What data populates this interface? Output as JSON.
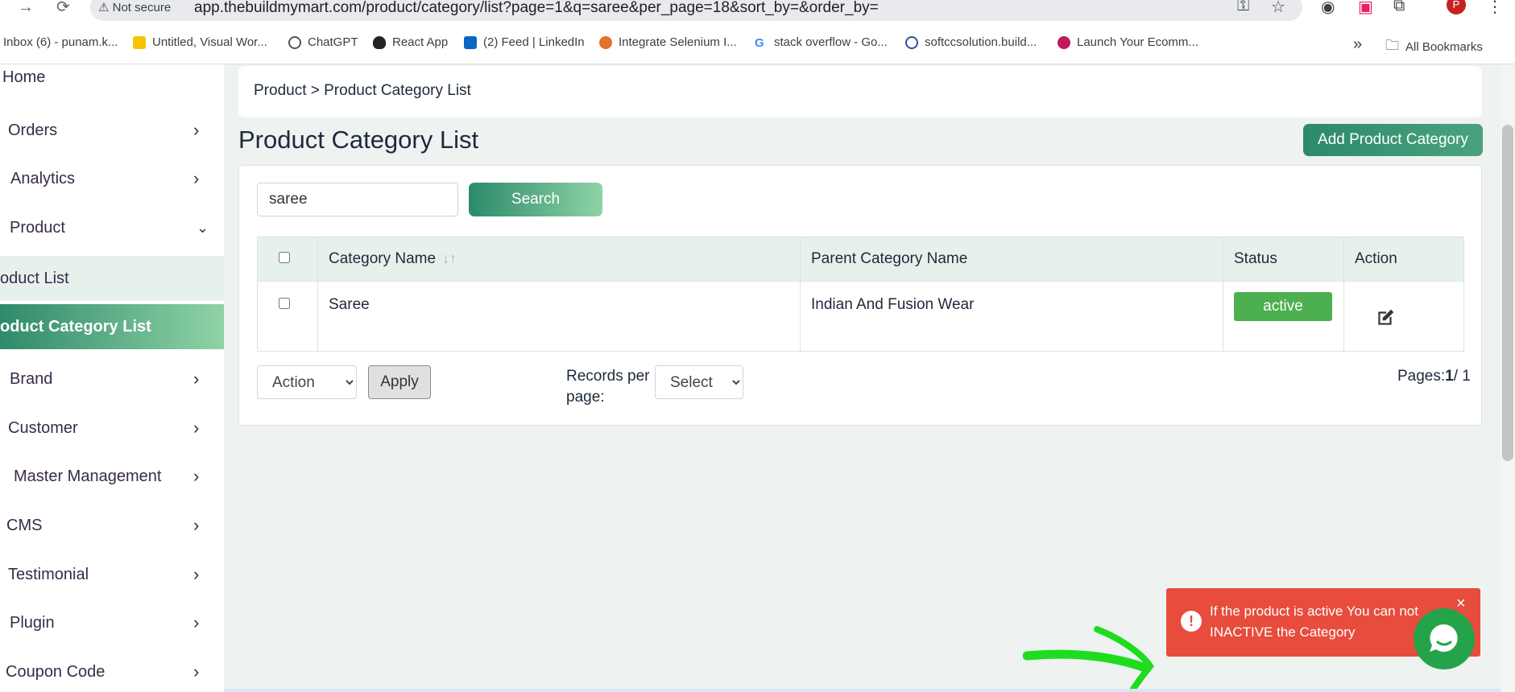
{
  "browser": {
    "security_label": "Not secure",
    "url": "app.thebuildmymart.com/product/category/list?page=1&q=saree&per_page=18&sort_by=&order_by=",
    "avatar_letter": "P",
    "bookmarks": [
      "Inbox (6) - punam.k...",
      "Untitled, Visual Wor...",
      "ChatGPT",
      "React App",
      "(2) Feed | LinkedIn",
      "Integrate Selenium I...",
      "stack overflow - Go...",
      "softccsolution.build...",
      "Launch Your Ecomm..."
    ],
    "all_bookmarks": "All Bookmarks",
    "more": "»"
  },
  "sidebar": {
    "home": "Home",
    "orders": "Orders",
    "analytics": "Analytics",
    "product": "Product",
    "product_list": "oduct List",
    "product_category_list": "oduct Category List",
    "brand": "Brand",
    "customer": "Customer",
    "master_management": "Master Management",
    "cms": "CMS",
    "testimonial": "Testimonial",
    "plugin": "Plugin",
    "coupon_code": "Coupon Code"
  },
  "breadcrumb": "Product > Product Category List",
  "page_title": "Product Category List",
  "add_button": "Add Product Category",
  "search": {
    "value": "saree",
    "button": "Search"
  },
  "table": {
    "headers": {
      "category_name": "Category Name",
      "parent_category_name": "Parent Category Name",
      "status": "Status",
      "action": "Action"
    },
    "rows": [
      {
        "category_name": "Saree",
        "parent_category_name": "Indian And Fusion Wear",
        "status": "active"
      }
    ]
  },
  "bulk": {
    "action_selected": "Action",
    "apply": "Apply"
  },
  "pagination": {
    "records_label": "Records per page:",
    "records_selected": "Select",
    "pages_label": "Pages:",
    "current_page": "1",
    "total_pages": "/ 1"
  },
  "toast": {
    "message": "If the product is active You can not INACTIVE the Category",
    "close": "×"
  },
  "colors": {
    "brand": "#2b8a6a",
    "active_status": "#4caf50",
    "toast_error": "#e74c3c"
  }
}
